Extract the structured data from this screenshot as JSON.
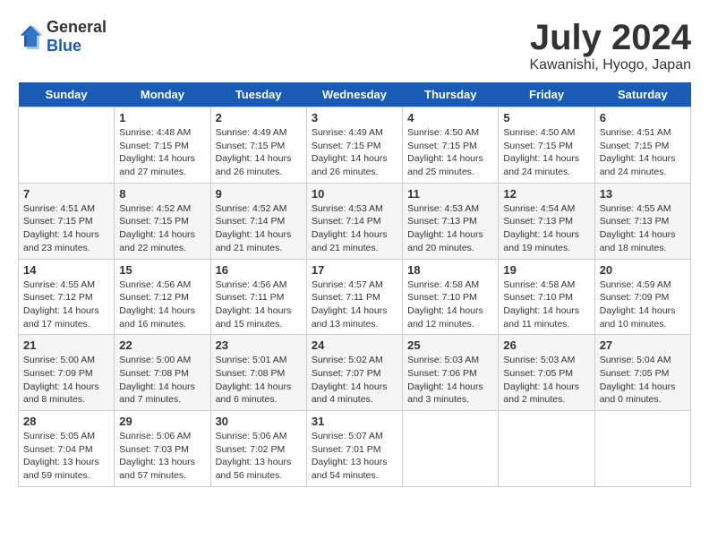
{
  "logo": {
    "text_general": "General",
    "text_blue": "Blue"
  },
  "title": {
    "month_year": "July 2024",
    "location": "Kawanishi, Hyogo, Japan"
  },
  "headers": [
    "Sunday",
    "Monday",
    "Tuesday",
    "Wednesday",
    "Thursday",
    "Friday",
    "Saturday"
  ],
  "weeks": [
    [
      {
        "day": "",
        "sunrise": "",
        "sunset": "",
        "daylight": ""
      },
      {
        "day": "1",
        "sunrise": "Sunrise: 4:48 AM",
        "sunset": "Sunset: 7:15 PM",
        "daylight": "Daylight: 14 hours and 27 minutes."
      },
      {
        "day": "2",
        "sunrise": "Sunrise: 4:49 AM",
        "sunset": "Sunset: 7:15 PM",
        "daylight": "Daylight: 14 hours and 26 minutes."
      },
      {
        "day": "3",
        "sunrise": "Sunrise: 4:49 AM",
        "sunset": "Sunset: 7:15 PM",
        "daylight": "Daylight: 14 hours and 26 minutes."
      },
      {
        "day": "4",
        "sunrise": "Sunrise: 4:50 AM",
        "sunset": "Sunset: 7:15 PM",
        "daylight": "Daylight: 14 hours and 25 minutes."
      },
      {
        "day": "5",
        "sunrise": "Sunrise: 4:50 AM",
        "sunset": "Sunset: 7:15 PM",
        "daylight": "Daylight: 14 hours and 24 minutes."
      },
      {
        "day": "6",
        "sunrise": "Sunrise: 4:51 AM",
        "sunset": "Sunset: 7:15 PM",
        "daylight": "Daylight: 14 hours and 24 minutes."
      }
    ],
    [
      {
        "day": "7",
        "sunrise": "Sunrise: 4:51 AM",
        "sunset": "Sunset: 7:15 PM",
        "daylight": "Daylight: 14 hours and 23 minutes."
      },
      {
        "day": "8",
        "sunrise": "Sunrise: 4:52 AM",
        "sunset": "Sunset: 7:15 PM",
        "daylight": "Daylight: 14 hours and 22 minutes."
      },
      {
        "day": "9",
        "sunrise": "Sunrise: 4:52 AM",
        "sunset": "Sunset: 7:14 PM",
        "daylight": "Daylight: 14 hours and 21 minutes."
      },
      {
        "day": "10",
        "sunrise": "Sunrise: 4:53 AM",
        "sunset": "Sunset: 7:14 PM",
        "daylight": "Daylight: 14 hours and 21 minutes."
      },
      {
        "day": "11",
        "sunrise": "Sunrise: 4:53 AM",
        "sunset": "Sunset: 7:13 PM",
        "daylight": "Daylight: 14 hours and 20 minutes."
      },
      {
        "day": "12",
        "sunrise": "Sunrise: 4:54 AM",
        "sunset": "Sunset: 7:13 PM",
        "daylight": "Daylight: 14 hours and 19 minutes."
      },
      {
        "day": "13",
        "sunrise": "Sunrise: 4:55 AM",
        "sunset": "Sunset: 7:13 PM",
        "daylight": "Daylight: 14 hours and 18 minutes."
      }
    ],
    [
      {
        "day": "14",
        "sunrise": "Sunrise: 4:55 AM",
        "sunset": "Sunset: 7:12 PM",
        "daylight": "Daylight: 14 hours and 17 minutes."
      },
      {
        "day": "15",
        "sunrise": "Sunrise: 4:56 AM",
        "sunset": "Sunset: 7:12 PM",
        "daylight": "Daylight: 14 hours and 16 minutes."
      },
      {
        "day": "16",
        "sunrise": "Sunrise: 4:56 AM",
        "sunset": "Sunset: 7:11 PM",
        "daylight": "Daylight: 14 hours and 15 minutes."
      },
      {
        "day": "17",
        "sunrise": "Sunrise: 4:57 AM",
        "sunset": "Sunset: 7:11 PM",
        "daylight": "Daylight: 14 hours and 13 minutes."
      },
      {
        "day": "18",
        "sunrise": "Sunrise: 4:58 AM",
        "sunset": "Sunset: 7:10 PM",
        "daylight": "Daylight: 14 hours and 12 minutes."
      },
      {
        "day": "19",
        "sunrise": "Sunrise: 4:58 AM",
        "sunset": "Sunset: 7:10 PM",
        "daylight": "Daylight: 14 hours and 11 minutes."
      },
      {
        "day": "20",
        "sunrise": "Sunrise: 4:59 AM",
        "sunset": "Sunset: 7:09 PM",
        "daylight": "Daylight: 14 hours and 10 minutes."
      }
    ],
    [
      {
        "day": "21",
        "sunrise": "Sunrise: 5:00 AM",
        "sunset": "Sunset: 7:09 PM",
        "daylight": "Daylight: 14 hours and 8 minutes."
      },
      {
        "day": "22",
        "sunrise": "Sunrise: 5:00 AM",
        "sunset": "Sunset: 7:08 PM",
        "daylight": "Daylight: 14 hours and 7 minutes."
      },
      {
        "day": "23",
        "sunrise": "Sunrise: 5:01 AM",
        "sunset": "Sunset: 7:08 PM",
        "daylight": "Daylight: 14 hours and 6 minutes."
      },
      {
        "day": "24",
        "sunrise": "Sunrise: 5:02 AM",
        "sunset": "Sunset: 7:07 PM",
        "daylight": "Daylight: 14 hours and 4 minutes."
      },
      {
        "day": "25",
        "sunrise": "Sunrise: 5:03 AM",
        "sunset": "Sunset: 7:06 PM",
        "daylight": "Daylight: 14 hours and 3 minutes."
      },
      {
        "day": "26",
        "sunrise": "Sunrise: 5:03 AM",
        "sunset": "Sunset: 7:05 PM",
        "daylight": "Daylight: 14 hours and 2 minutes."
      },
      {
        "day": "27",
        "sunrise": "Sunrise: 5:04 AM",
        "sunset": "Sunset: 7:05 PM",
        "daylight": "Daylight: 14 hours and 0 minutes."
      }
    ],
    [
      {
        "day": "28",
        "sunrise": "Sunrise: 5:05 AM",
        "sunset": "Sunset: 7:04 PM",
        "daylight": "Daylight: 13 hours and 59 minutes."
      },
      {
        "day": "29",
        "sunrise": "Sunrise: 5:06 AM",
        "sunset": "Sunset: 7:03 PM",
        "daylight": "Daylight: 13 hours and 57 minutes."
      },
      {
        "day": "30",
        "sunrise": "Sunrise: 5:06 AM",
        "sunset": "Sunset: 7:02 PM",
        "daylight": "Daylight: 13 hours and 56 minutes."
      },
      {
        "day": "31",
        "sunrise": "Sunrise: 5:07 AM",
        "sunset": "Sunset: 7:01 PM",
        "daylight": "Daylight: 13 hours and 54 minutes."
      },
      {
        "day": "",
        "sunrise": "",
        "sunset": "",
        "daylight": ""
      },
      {
        "day": "",
        "sunrise": "",
        "sunset": "",
        "daylight": ""
      },
      {
        "day": "",
        "sunrise": "",
        "sunset": "",
        "daylight": ""
      }
    ]
  ]
}
